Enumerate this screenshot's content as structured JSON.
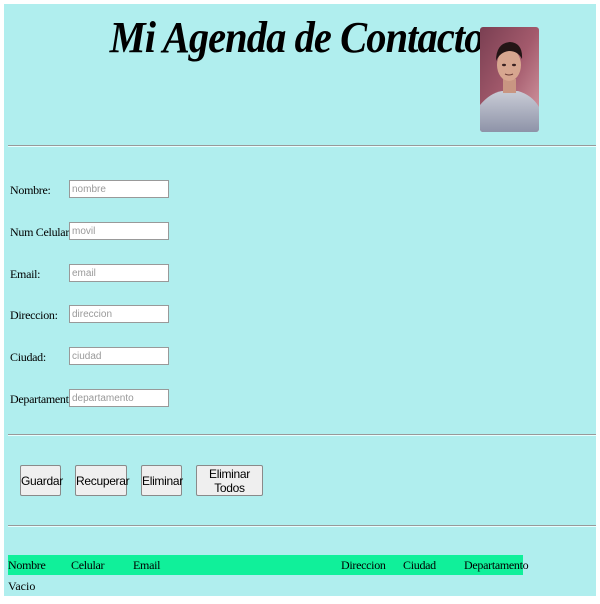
{
  "header": {
    "title": "Mi Agenda de Contactos"
  },
  "form": {
    "fields": [
      {
        "label": "Nombre:",
        "placeholder": "nombre",
        "value": ""
      },
      {
        "label": "Num Celular:",
        "placeholder": "movil",
        "value": ""
      },
      {
        "label": "Email:",
        "placeholder": "email",
        "value": ""
      },
      {
        "label": "Direccion:",
        "placeholder": "direccion",
        "value": ""
      },
      {
        "label": "Ciudad:",
        "placeholder": "ciudad",
        "value": ""
      },
      {
        "label": "Departamento:",
        "placeholder": "departamento",
        "value": ""
      }
    ]
  },
  "actions": {
    "guardar": "Guardar",
    "recuperar": "Recuperar",
    "eliminar": "Eliminar",
    "eliminar_todos": "Eliminar Todos"
  },
  "table": {
    "columns": [
      "Nombre",
      "Celular",
      "Email",
      "Direccion",
      "Ciudad",
      "Departamento"
    ],
    "empty_text": "Vacio"
  },
  "colors": {
    "page_background": "#b0eeee",
    "table_header": "#10f09a"
  }
}
